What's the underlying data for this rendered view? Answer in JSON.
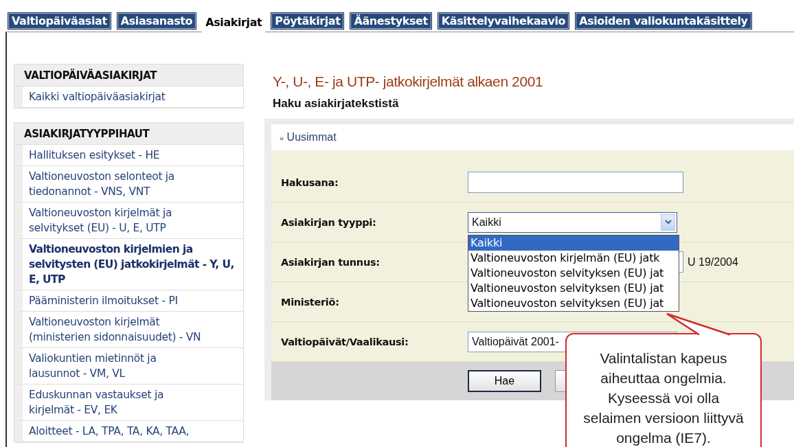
{
  "tabs": [
    {
      "label": "Valtiopäiväasiat",
      "selected": false
    },
    {
      "label": "Asiasanasto",
      "selected": false
    },
    {
      "label": "Asiakirjat",
      "selected": true
    },
    {
      "label": "Pöytäkirjat",
      "selected": false
    },
    {
      "label": "Äänestykset",
      "selected": false
    },
    {
      "label": "Käsittelyvaihekaavio",
      "selected": false
    },
    {
      "label": "Asioiden valiokuntakäsittely",
      "selected": false
    }
  ],
  "sidebar": {
    "sections": [
      {
        "title": "VALTIOPÄIVÄASIAKIRJAT",
        "items": [
          {
            "label": "Kaikki valtiopäiväasiakirjat",
            "selected": false
          }
        ]
      },
      {
        "title": "ASIAKIRJATYYPPIHAUT",
        "items": [
          {
            "label": "Hallituksen esitykset - HE",
            "selected": false
          },
          {
            "label": "Valtioneuvoston selonteot ja tiedonannot - VNS, VNT",
            "selected": false
          },
          {
            "label": "Valtioneuvoston kirjelmät ja selvitykset (EU) - U, E, UTP",
            "selected": false
          },
          {
            "label": "Valtioneuvoston kirjelmien ja selvitysten (EU) jatkokirjelmät - Y, U, E, UTP",
            "selected": true
          },
          {
            "label": "Pääministerin ilmoitukset - PI",
            "selected": false
          },
          {
            "label": "Valtioneuvoston kirjelmät (ministerien sidonnaisuudet) - VN",
            "selected": false
          },
          {
            "label": "Valiokuntien mietinnöt ja lausunnot - VM, VL",
            "selected": false
          },
          {
            "label": "Eduskunnan vastaukset ja kirjelmät - EV, EK",
            "selected": false
          },
          {
            "label": "Aloitteet - LA, TPA, TA, KA, TAA,",
            "selected": false
          }
        ]
      }
    ]
  },
  "main": {
    "title": "Y-, U-, E- ja UTP- jatkokirjelmät alkaen 2001",
    "subtitle": "Haku asiakirjatekstistä",
    "link": {
      "marker": "»",
      "label": "Uusimmat"
    },
    "form": [
      {
        "kind": "text",
        "label": "Hakusana:"
      },
      {
        "kind": "select",
        "label": "Asiakirjan tyyppi:",
        "value": "Kaikki",
        "expanded": true,
        "options": [
          {
            "label": "Kaikki",
            "selected": true
          },
          {
            "label": "Valtioneuvoston kirjelmän (EU) jatk",
            "selected": false
          },
          {
            "label": "Valtioneuvoston selvityksen (EU) jat",
            "selected": false
          },
          {
            "label": "Valtioneuvoston selvityksen (EU) jat",
            "selected": false
          },
          {
            "label": "Valtioneuvoston selvityksen (EU) jat",
            "selected": false
          }
        ]
      },
      {
        "kind": "text",
        "label": "Asiakirjan tunnus:",
        "hint": "U 19/2004"
      },
      {
        "kind": "blank",
        "label": "Ministeriö:"
      },
      {
        "kind": "select",
        "label": "Valtiopäivät/Vaalikausi:",
        "value": "Valtiopäivät 2001-",
        "expanded": false
      }
    ],
    "buttons": [
      "Hae"
    ]
  },
  "callout": {
    "text": "Valintalistan kapeus aiheuttaa ongelmia. Kyseessä voi olla selaimen versioon liittyvä ongelma (IE7)."
  }
}
